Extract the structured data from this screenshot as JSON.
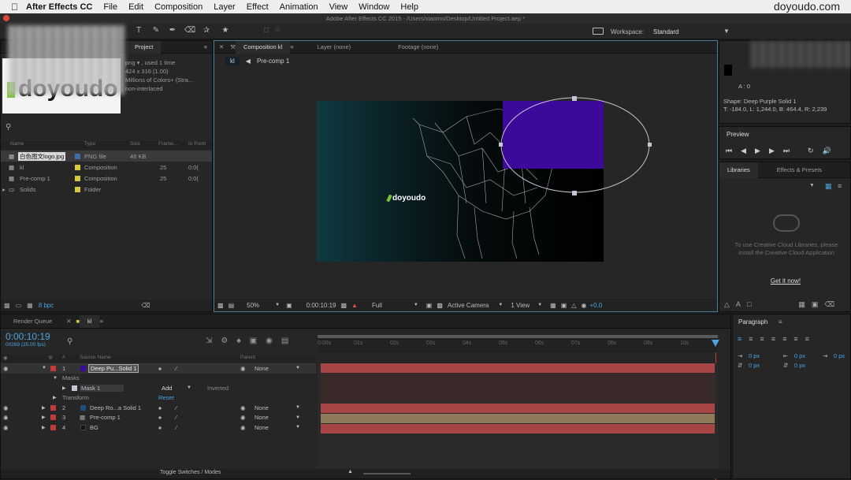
{
  "menubar": {
    "app": "After Effects CC",
    "items": [
      "File",
      "Edit",
      "Composition",
      "Layer",
      "Effect",
      "Animation",
      "View",
      "Window",
      "Help"
    ],
    "watermark": "doyoudo.com"
  },
  "window_title": "Adobe After Effects CC 2015 - /Users/xiaomo/Desktop/Untitled Project.aep *",
  "workspace": {
    "label": "Workspace:",
    "value": "Standard"
  },
  "project": {
    "tabs": [
      "Project"
    ],
    "info": [
      "png ▾ , used 1 time",
      "424 x 316 (1.00)",
      "Millions of Colors+ (Stra...",
      "non-interlaced"
    ],
    "thumb_text": "doyoudo",
    "columns": [
      "Name",
      "Type",
      "Size",
      "Frame...",
      "In Point"
    ],
    "items": [
      {
        "name": "白色图文logo.jpg",
        "type": "PNG file",
        "size": "48 KB",
        "frame": "",
        "in": "",
        "color": "#3c6fa8"
      },
      {
        "name": "kl",
        "type": "Composition",
        "size": "",
        "frame": "25",
        "in": "0:0(",
        "color": "#d8c840"
      },
      {
        "name": "Pre-comp 1",
        "type": "Composition",
        "size": "",
        "frame": "25",
        "in": "0:0(",
        "color": "#d8c840"
      },
      {
        "name": "Solids",
        "type": "Folder",
        "size": "",
        "frame": "",
        "in": "",
        "color": "#d8c840"
      }
    ],
    "bpc": "8 bpc"
  },
  "comp": {
    "tabs": [
      "Composition kl",
      "Layer (none)",
      "Footage (none)"
    ],
    "breadcrumb": [
      "kl",
      "Pre-comp 1"
    ],
    "logo_text": "doyoudo",
    "zoom": "50%",
    "timecode": "0:00:10:19",
    "resolution": "Full",
    "camera": "Active Camera",
    "views": "1 View",
    "exposure": "+0.0",
    "solid_color": "#3b0a9a",
    "mask_color": "#c9c3d6"
  },
  "info_panel": {
    "a_label": "A : 0",
    "shape": "Shape: Deep Purple Solid 1",
    "bounds": "T: -184.0, L: 1,244.0, B: 464.4, R: 2,239"
  },
  "preview": {
    "title": "Preview"
  },
  "libraries": {
    "tabs": [
      "Libraries",
      "Effects & Presets"
    ],
    "message": "To use Creative Cloud Libraries, please install the Creative Cloud Application",
    "link": "Get it now!"
  },
  "timeline": {
    "tabs": [
      "Render Queue",
      "kl"
    ],
    "timecode": "0:00:10:19",
    "frames": "00269 (25.00 fps)",
    "ruler": [
      "0:00s",
      "01s",
      "02s",
      "03s",
      "04s",
      "05s",
      "06s",
      "07s",
      "08s",
      "09s",
      "10s"
    ],
    "col_source": "Source Name",
    "col_parent": "Parent",
    "layers": [
      {
        "num": "1",
        "name": "Deep Pu...Solid 1",
        "parent": "None",
        "label": "#c23a3a",
        "icon": "#3b0a9a",
        "bar": "#a84646"
      },
      {
        "num": "2",
        "name": "Deep Ro...a Solid 1",
        "parent": "None",
        "label": "#c23a3a",
        "icon": "#1e4f7a",
        "bar": "#a84646"
      },
      {
        "num": "3",
        "name": "Pre-comp 1",
        "parent": "None",
        "label": "#c23a3a",
        "icon": "#888888",
        "bar": "#8f7a5a"
      },
      {
        "num": "4",
        "name": "BG",
        "parent": "None",
        "label": "#c23a3a",
        "icon": "#111111",
        "bar": "#a84646"
      }
    ],
    "masks_label": "Masks",
    "mask1": "Mask 1",
    "mask_mode": "Add",
    "inverted": "Inverted",
    "transform": "Transform",
    "reset": "Reset",
    "footer": "Toggle Switches / Modes"
  },
  "paragraph": {
    "title": "Paragraph",
    "values": [
      "0 px",
      "0 px",
      "0 px",
      "0 px",
      "0 px"
    ]
  }
}
